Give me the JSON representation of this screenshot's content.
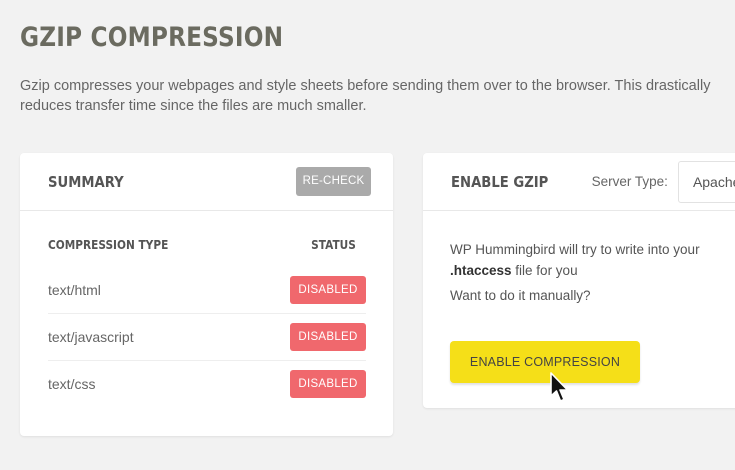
{
  "page": {
    "title": "GZIP COMPRESSION",
    "intro": "Gzip compresses your webpages and style sheets before sending them over to the browser. This drastically reduces transfer time since the files are much smaller."
  },
  "summary": {
    "title": "SUMMARY",
    "recheck_label": "RE-CHECK",
    "columns": {
      "type": "COMPRESSION TYPE",
      "status": "STATUS"
    },
    "rows": [
      {
        "type": "text/html",
        "status": "DISABLED"
      },
      {
        "type": "text/javascript",
        "status": "DISABLED"
      },
      {
        "type": "text/css",
        "status": "DISABLED"
      }
    ],
    "status_color": "#f0686d"
  },
  "enable": {
    "title": "ENABLE GZIP",
    "server_label": "Server Type:",
    "server_value": "Apache",
    "text_before": "WP Hummingbird will try to write into your ",
    "text_bold": ".htaccess",
    "text_after": " file for you",
    "manual_text": "Want to do it manually?",
    "button_label": "ENABLE COMPRESSION",
    "button_color": "#f5df18"
  },
  "cursor_icon": "mouse-pointer-icon"
}
